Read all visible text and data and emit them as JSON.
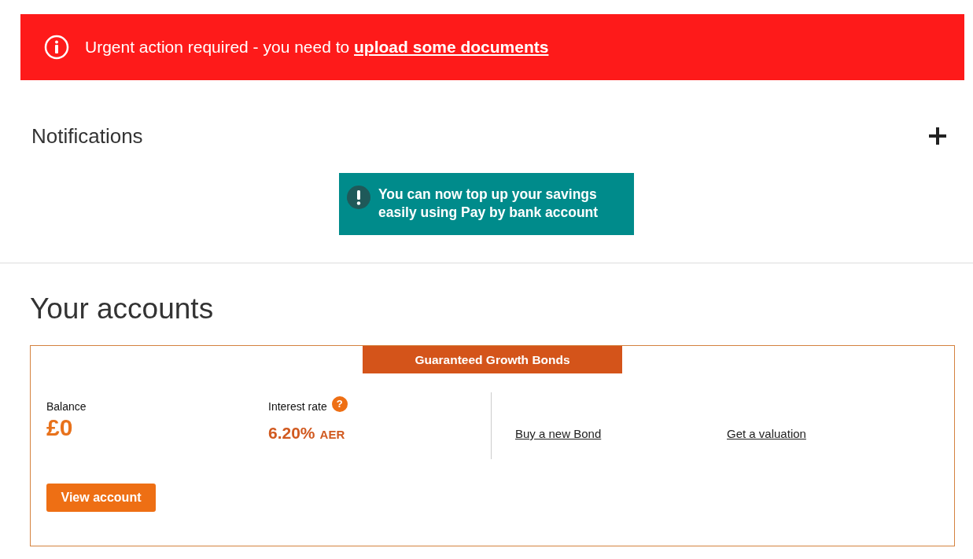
{
  "alert": {
    "text": "Urgent action required - you need to",
    "link": "upload some documents"
  },
  "notifications": {
    "title": "Notifications",
    "expanded": false,
    "message": "You can now top up your savings easily using Pay by bank account"
  },
  "accounts": {
    "title": "Your accounts",
    "items": [
      {
        "name": "Guaranteed Growth Bonds",
        "balance_label": "Balance",
        "balance": "£0",
        "rate_label": "Interest rate",
        "rate": "6.20%",
        "rate_unit": "AER",
        "help": "?",
        "links": [
          "Buy a new Bond",
          "Get a valuation"
        ],
        "button": "View account"
      }
    ]
  }
}
